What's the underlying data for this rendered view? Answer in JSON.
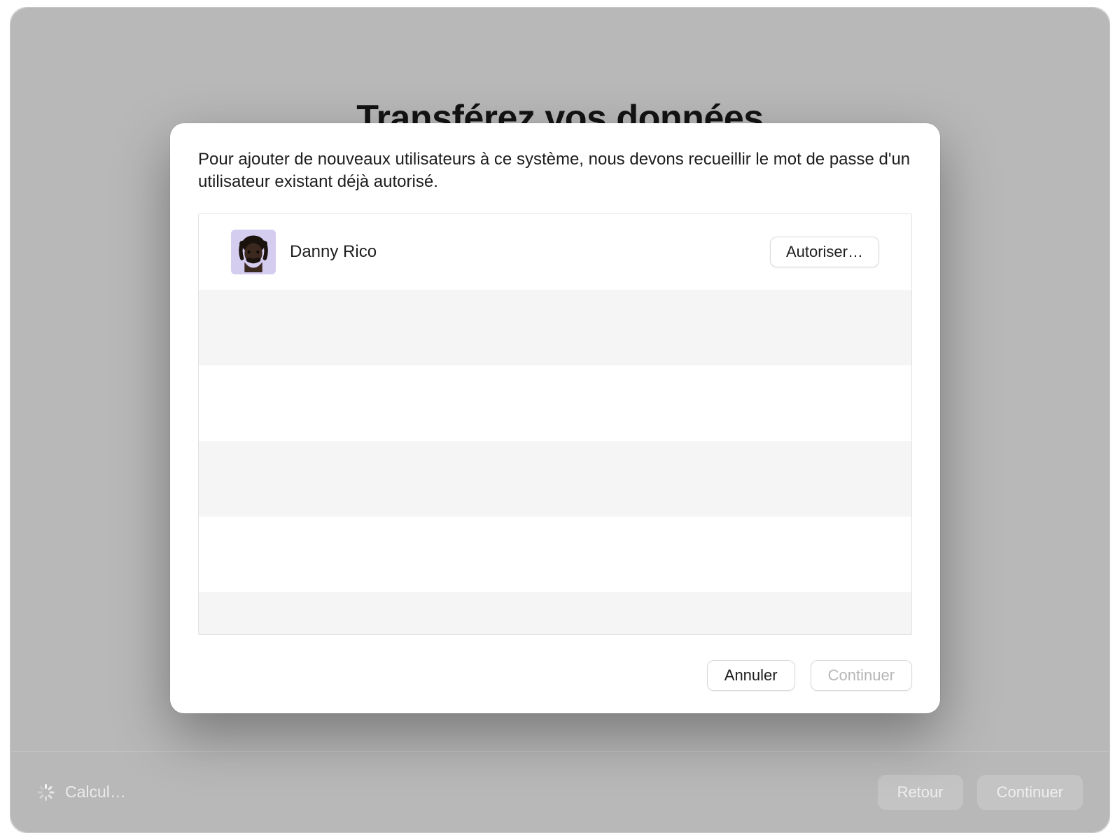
{
  "background": {
    "title": "Transférez vos données",
    "footer": {
      "status": "Calcul…",
      "back_label": "Retour",
      "continue_label": "Continuer"
    }
  },
  "dialog": {
    "message": "Pour ajouter de nouveaux utilisateurs à ce système, nous devons recueillir le mot de passe d'un utilisateur existant déjà autorisé.",
    "users": [
      {
        "name": "Danny Rico",
        "authorize_label": "Autoriser…"
      }
    ],
    "cancel_label": "Annuler",
    "continue_label": "Continuer"
  }
}
